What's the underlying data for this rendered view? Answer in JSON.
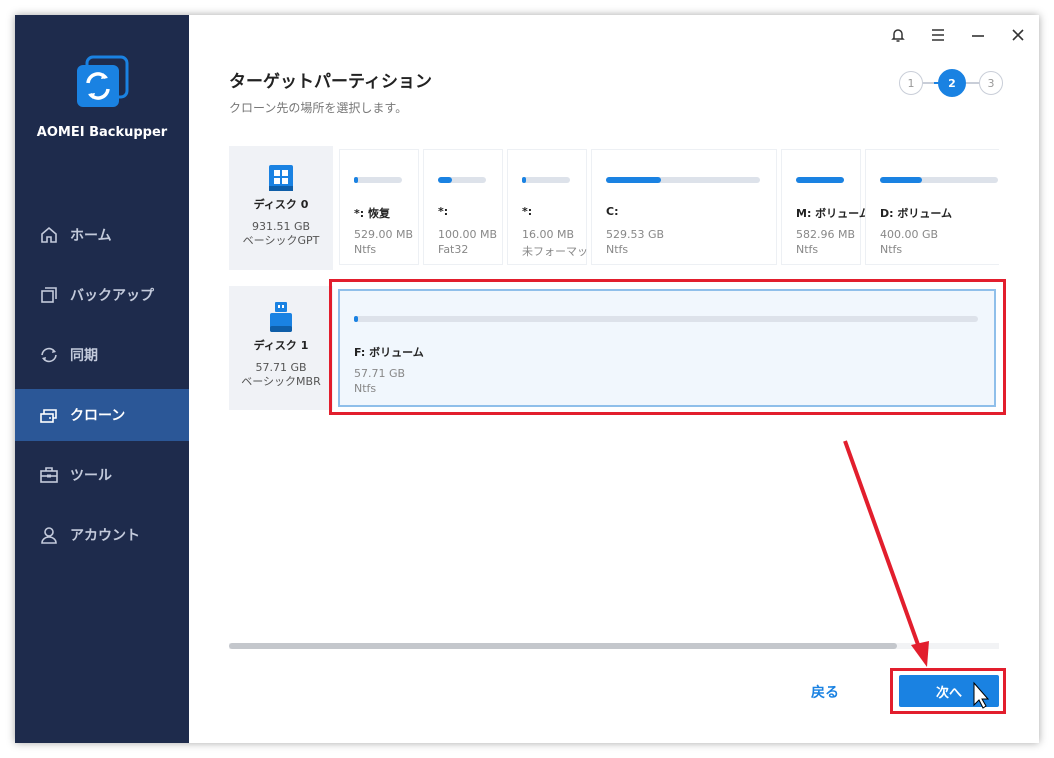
{
  "app": {
    "name": "AOMEI Backupper"
  },
  "sidebar": {
    "items": [
      {
        "label": "ホーム",
        "icon": "home-icon"
      },
      {
        "label": "バックアップ",
        "icon": "backup-icon"
      },
      {
        "label": "同期",
        "icon": "sync-icon"
      },
      {
        "label": "クローン",
        "icon": "clone-icon",
        "active": true
      },
      {
        "label": "ツール",
        "icon": "toolbox-icon"
      },
      {
        "label": "アカウント",
        "icon": "user-icon"
      }
    ]
  },
  "header": {
    "title": "ターゲットパーティション",
    "subtitle": "クローン先の場所を選択します。",
    "steps": [
      "1",
      "2",
      "3"
    ],
    "current_step": 2
  },
  "disks": [
    {
      "name": "ディスク 0",
      "size": "931.51 GB",
      "type": "ベーシックGPT",
      "icon": "windows-disk-icon",
      "partitions": [
        {
          "label": "*: 恢复",
          "size": "529.00 MB",
          "fs": "Ntfs",
          "used": 0.03
        },
        {
          "label": "*:",
          "size": "100.00 MB",
          "fs": "Fat32",
          "used": 0.3
        },
        {
          "label": "*:",
          "size": "16.00 MB",
          "fs": "未フォーマット",
          "used": 0.03
        },
        {
          "label": "C:",
          "size": "529.53 GB",
          "fs": "Ntfs",
          "used": 0.36
        },
        {
          "label": "M: ボリューム",
          "size": "582.96 MB",
          "fs": "Ntfs",
          "used": 1.0
        },
        {
          "label": "D: ボリューム",
          "size": "400.00 GB",
          "fs": "Ntfs",
          "used": 0.36
        }
      ]
    },
    {
      "name": "ディスク 1",
      "size": "57.71 GB",
      "type": "ベーシックMBR",
      "icon": "usb-drive-icon",
      "partitions": [
        {
          "label": "F: ボリューム",
          "size": "57.71 GB",
          "fs": "Ntfs",
          "used": 0.005,
          "selected": true
        }
      ]
    }
  ],
  "footer": {
    "back_label": "戻る",
    "next_label": "次へ"
  },
  "colors": {
    "accent": "#1a82e2",
    "sidebar_bg": "#1e2b4c",
    "sidebar_active": "#2b5797",
    "highlight": "#e21e2d"
  }
}
